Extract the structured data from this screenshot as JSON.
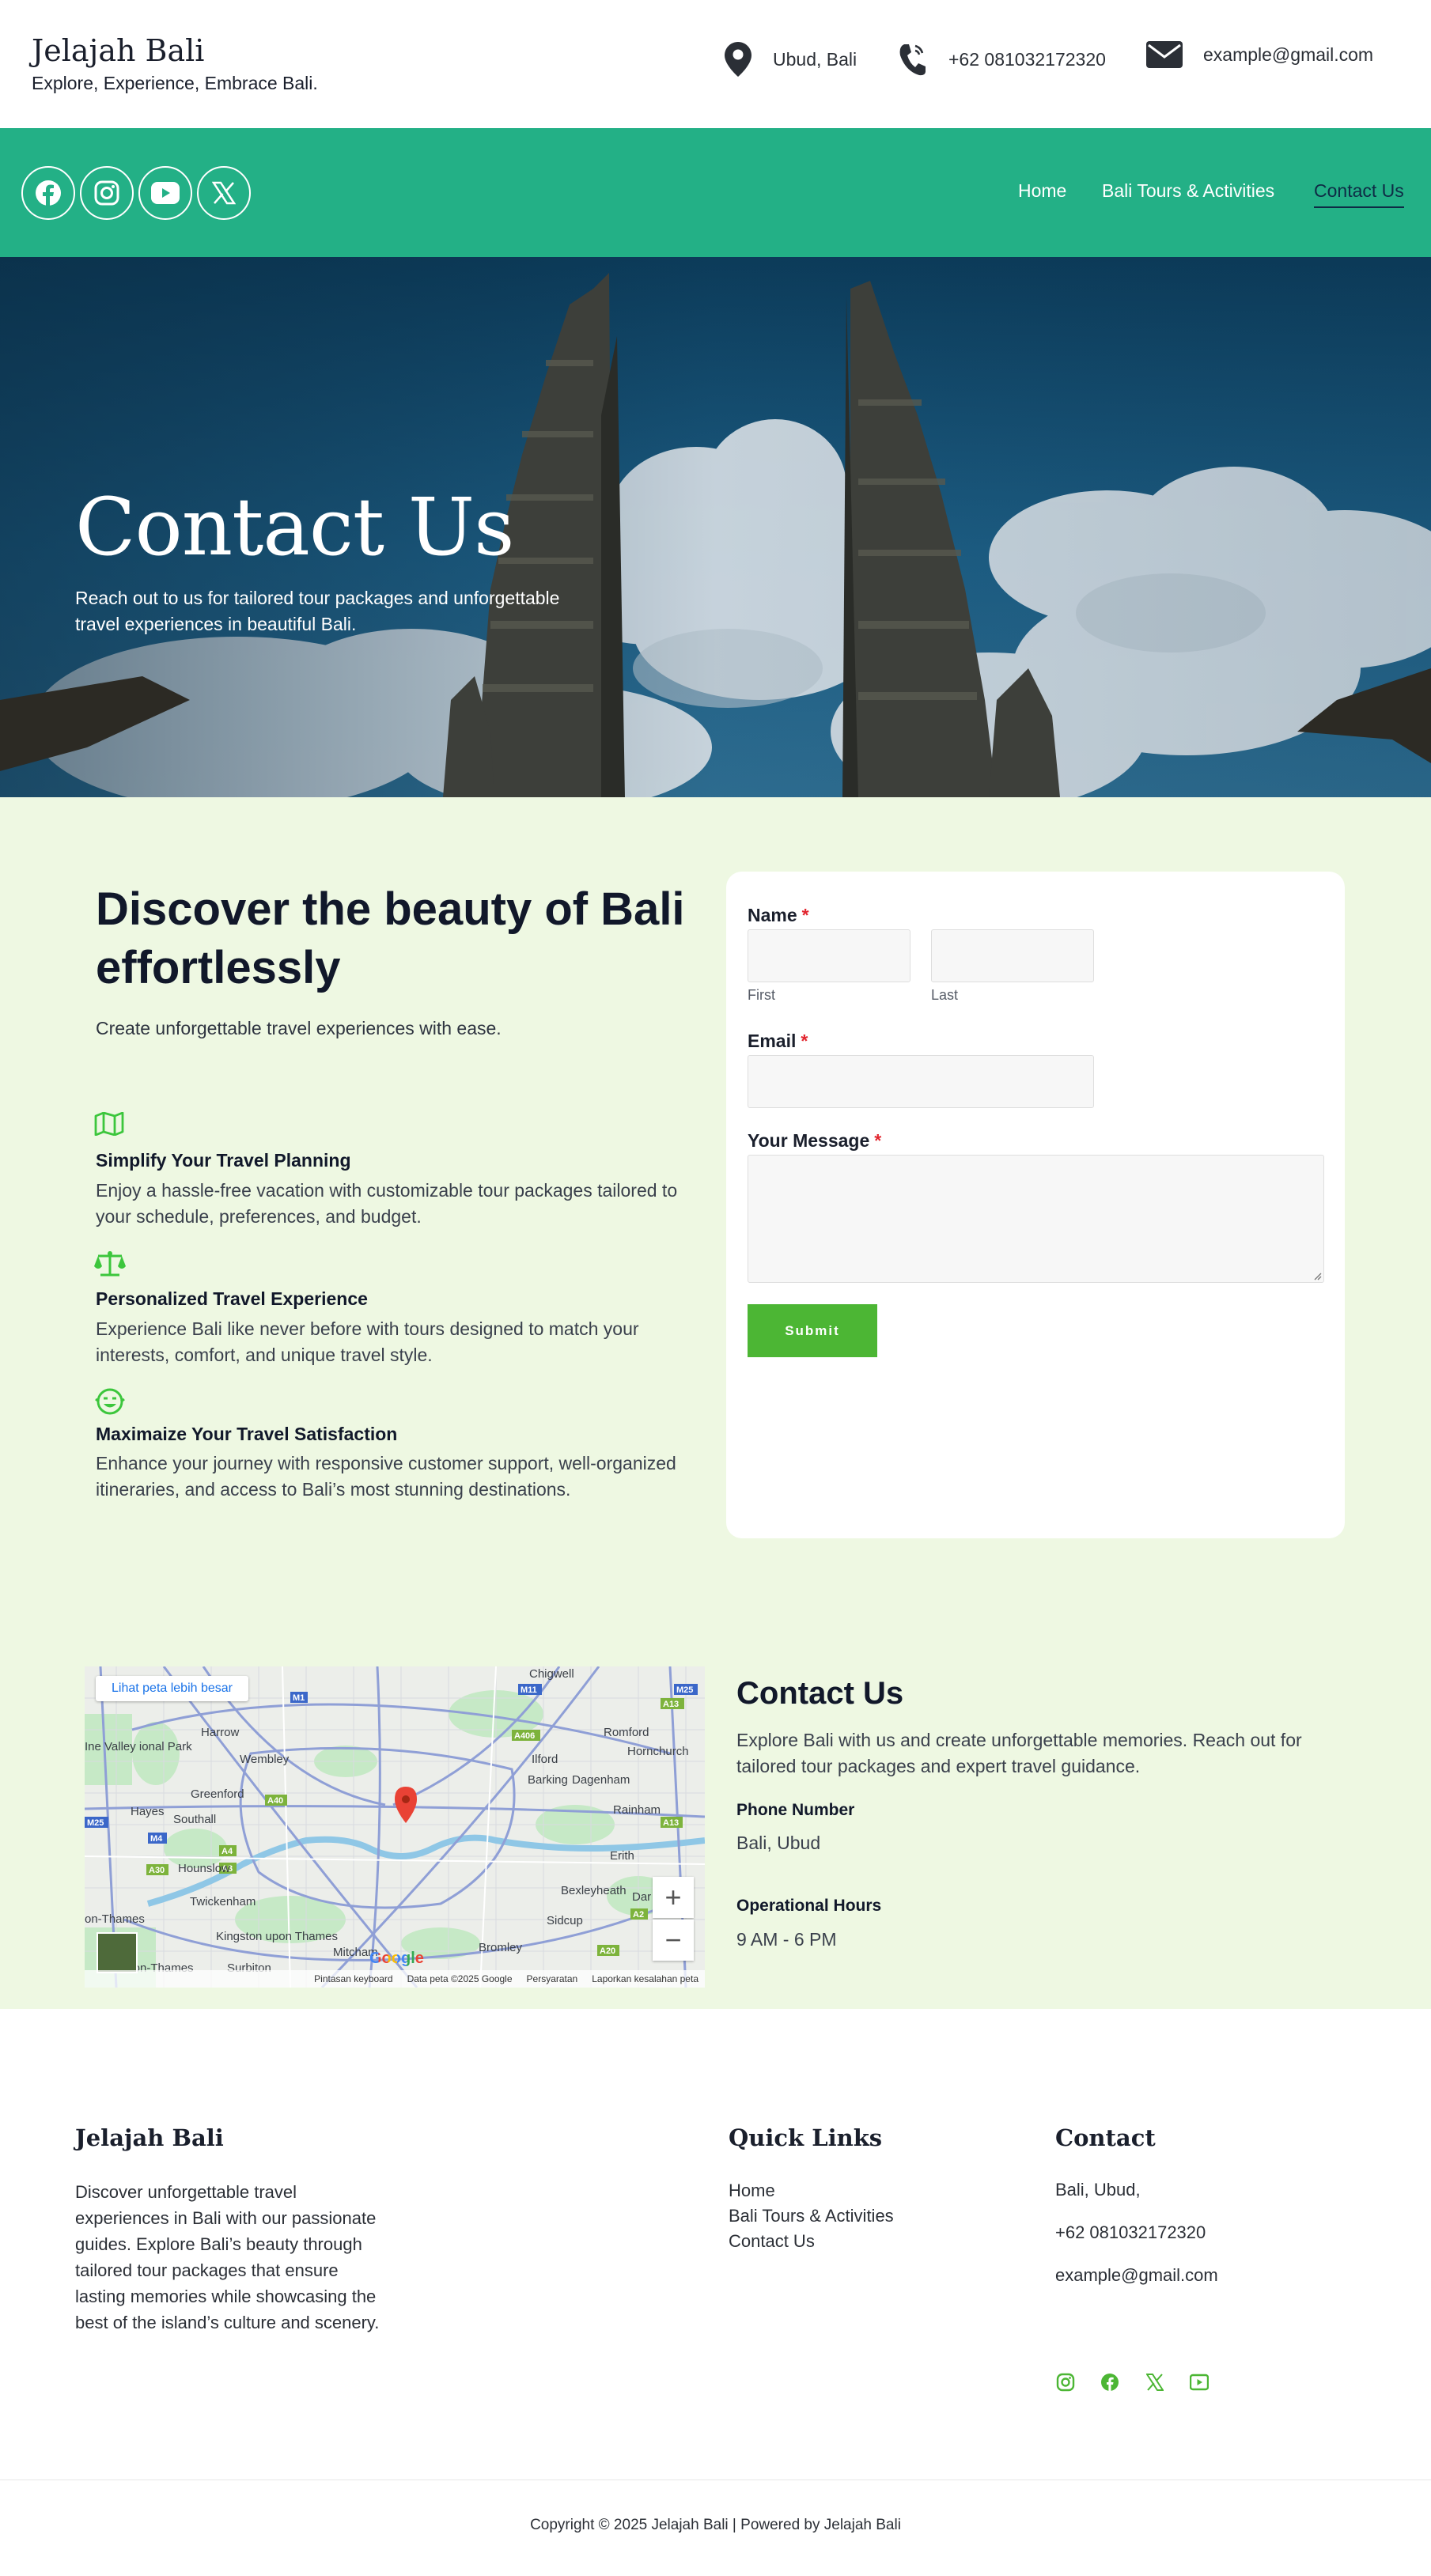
{
  "header": {
    "brand_title": "Jelajah Bali",
    "brand_tagline": "Explore, Experience, Embrace Bali.",
    "location": "Ubud, Bali",
    "phone": "+62 081032172320",
    "email": "example@gmail.com"
  },
  "nav": {
    "socials": [
      "facebook-icon",
      "instagram-icon",
      "youtube-icon",
      "x-icon"
    ],
    "links": [
      "Home",
      "Bali Tours & Activities",
      "Contact Us"
    ],
    "active": "Contact Us",
    "bar_color": "#23b086"
  },
  "hero": {
    "title": "Contact Us",
    "subtitle": "Reach out to us for tailored tour packages and unforgettable travel experiences in beautiful Bali."
  },
  "discover": {
    "title": "Discover the beauty of Bali effortlessly",
    "subtitle": "Create unforgettable travel experiences with ease.",
    "features": [
      {
        "icon": "map-icon",
        "title": "Simplify Your Travel Planning",
        "text": "Enjoy a hassle-free vacation with customizable tour packages tailored to your schedule, preferences, and budget."
      },
      {
        "icon": "balance-scale-icon",
        "title": "Personalized Travel Experience",
        "text": "Experience Bali like never before with tours designed to match your interests, comfort, and unique travel style."
      },
      {
        "icon": "smile-icon",
        "title": "Maximaize Your Travel Satisfaction",
        "text": "Enhance your journey with responsive customer support, well-organized itineraries, and access to Bali’s most stunning destinations."
      }
    ],
    "accent_color": "#3cc63c"
  },
  "form": {
    "name_label": "Name",
    "first_hint": "First",
    "last_hint": "Last",
    "email_label": "Email",
    "message_label": "Your Message",
    "required_mark": "*",
    "submit_label": "Submit",
    "submit_color": "#4cb634"
  },
  "map": {
    "view_larger": "Lihat peta lebih besar",
    "zoom_in": "+",
    "zoom_out": "−",
    "google": "Google",
    "footer_items": [
      "Pintasan keyboard",
      "Data peta ©2025 Google",
      "Persyaratan",
      "Laporkan kesalahan peta"
    ],
    "places": [
      "Chigwell",
      "Harrow",
      "Wembley",
      "Romford",
      "Hornchurch",
      "Ilford",
      "Barking",
      "Dagenham",
      "Greenford",
      "Hayes",
      "Southall",
      "Rainham",
      "Hounslow",
      "Erith",
      "Twickenham",
      "Bexleyheath",
      "Sidcup",
      "Kingston upon Thames",
      "Mitcham",
      "Bromley",
      "Surbiton",
      "Ine Valley ional Park",
      "on-Thames",
      "on-on-Thames",
      "Dar"
    ],
    "road_labels": [
      "M1",
      "M11",
      "M25",
      "A406",
      "A13",
      "A40",
      "A4",
      "A30",
      "M4",
      "A3",
      "A20",
      "A2"
    ]
  },
  "contact_info": {
    "title": "Contact Us",
    "description": "Explore Bali with us and create unforgettable memories. Reach out for tailored tour packages and expert travel guidance.",
    "phone_label": "Phone Number",
    "phone_value": "Bali, Ubud",
    "hours_label": "Operational Hours",
    "hours_value": "9 AM - 6 PM"
  },
  "footer": {
    "about_title": "Jelajah Bali",
    "about_text": "Discover unforgettable travel experiences in Bali with our passionate guides. Explore Bali’s beauty through tailored tour packages that ensure lasting memories while showcasing the best of the island’s culture and scenery.",
    "links_title": "Quick Links",
    "links": [
      "Home",
      "Bali Tours & Activities",
      "Contact Us"
    ],
    "contact_title": "Contact",
    "contact_lines": [
      "Bali, Ubud,",
      "+62 081032172320",
      "example@gmail.com"
    ],
    "socials": [
      "instagram-icon",
      "facebook-icon",
      "x-icon",
      "youtube-icon"
    ],
    "social_color": "#4cb634",
    "copyright": "Copyright © 2025 Jelajah Bali | Powered by Jelajah Bali"
  }
}
